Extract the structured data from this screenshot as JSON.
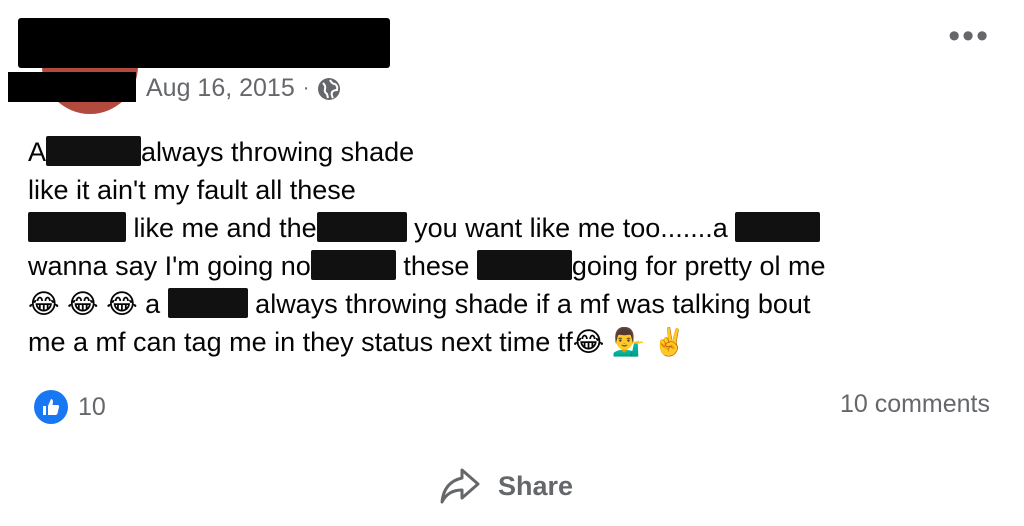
{
  "post": {
    "date": "Aug 16, 2015",
    "separator": "·",
    "privacy_icon": "globe-icon",
    "more_label": "•••",
    "lines": [
      {
        "segments": [
          {
            "t": "A"
          },
          {
            "redact": 95
          },
          {
            "t": "always throwing shade"
          }
        ]
      },
      {
        "segments": [
          {
            "t": "like it ain't my fault all these"
          }
        ]
      },
      {
        "segments": [
          {
            "redact": 98
          },
          {
            "t": " like me and the"
          },
          {
            "redact": 90
          },
          {
            "t": " you want like me too.......a "
          },
          {
            "redact": 85
          }
        ]
      },
      {
        "segments": [
          {
            "t": "wanna say I'm going no"
          },
          {
            "redact": 85
          },
          {
            "t": " these "
          },
          {
            "redact": 95
          },
          {
            "t": "going for pretty ol me"
          }
        ]
      },
      {
        "segments": [
          {
            "t": "😂 😂 😂 a "
          },
          {
            "redact": 80
          },
          {
            "t": " always throwing shade if a mf was talking bout"
          }
        ]
      },
      {
        "segments": [
          {
            "t": "me a mf can tag me in they status next time tf😂 💁‍♂️ ✌️"
          }
        ]
      }
    ]
  },
  "footer": {
    "like_count": "10",
    "comments_label": "10 comments",
    "share_label": "Share"
  },
  "colors": {
    "like_blue": "#1877f2",
    "meta_gray": "#65676b"
  }
}
